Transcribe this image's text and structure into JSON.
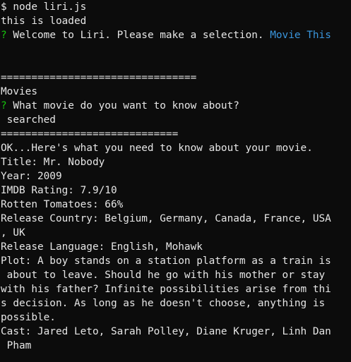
{
  "colors": {
    "background": "#0c0c0c",
    "text": "#e6e6e6",
    "prompt_question_mark": "#16c60c",
    "selection_answer": "#3a96dd"
  },
  "lines": {
    "command": "$ node liri.js",
    "loaded": "this is loaded",
    "q1_mark": "?",
    "q1_text": " Welcome to Liri. Please make a selection. ",
    "q1_answer": "Movie This",
    "divider1": "================================",
    "category": "Movies",
    "q2_mark": "?",
    "q2_text": " What movie do you want to know about?",
    "searched": " searched",
    "divider2": "=============================",
    "ok": "OK...Here's what you need to know about your movie.",
    "title": "Title: Mr. Nobody",
    "year": "Year: 2009",
    "imdb": "IMDB Rating: 7.9/10",
    "rotten": "Rotten Tomatoes: 66%",
    "country_1": "Release Country: Belgium, Germany, Canada, France, USA",
    "country_2": ", UK",
    "language": "Release Language: English, Mohawk",
    "plot_1": "Plot: A boy stands on a station platform as a train is",
    "plot_2": " about to leave. Should he go with his mother or stay",
    "plot_3": "with his father? Infinite possibilities arise from thi",
    "plot_4": "s decision. As long as he doesn't choose, anything is",
    "plot_5": "possible.",
    "cast_1": "Cast: Jared Leto, Sarah Polley, Diane Kruger, Linh Dan",
    "cast_2": " Pham"
  }
}
